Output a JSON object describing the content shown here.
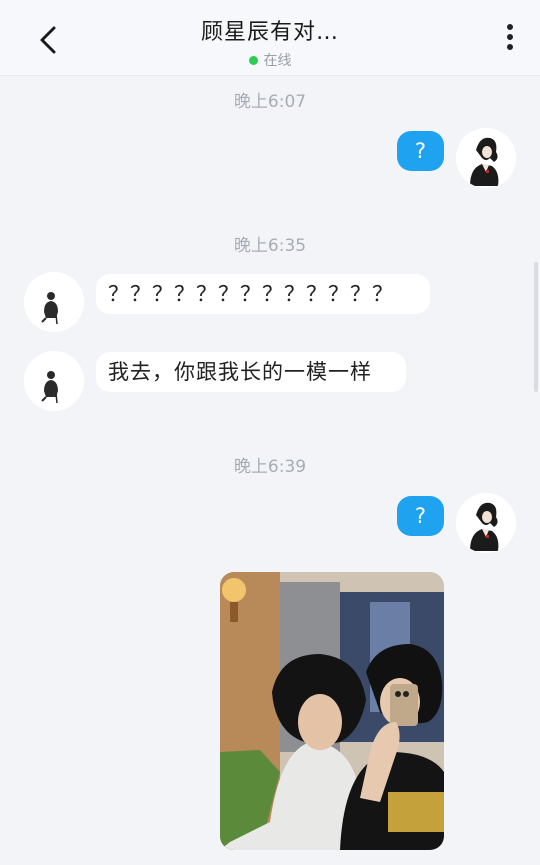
{
  "header": {
    "title": "顾星辰有对…",
    "status": "在线",
    "status_color": "#2ecc52"
  },
  "messages": {
    "ts1": "晚上6:07",
    "me1": "?",
    "ts2": "晚上6:35",
    "other1": "？？？？？？？？？？？？？",
    "other2": "我去，你跟我长的一模一样",
    "ts3": "晚上6:39",
    "me2": "?"
  },
  "icons": {
    "back": "chevron-left-icon",
    "more": "more-vertical-icon"
  },
  "colors": {
    "my_bubble": "#1fa3f0",
    "other_bubble": "#ffffff",
    "background": "#f3f4f8"
  }
}
